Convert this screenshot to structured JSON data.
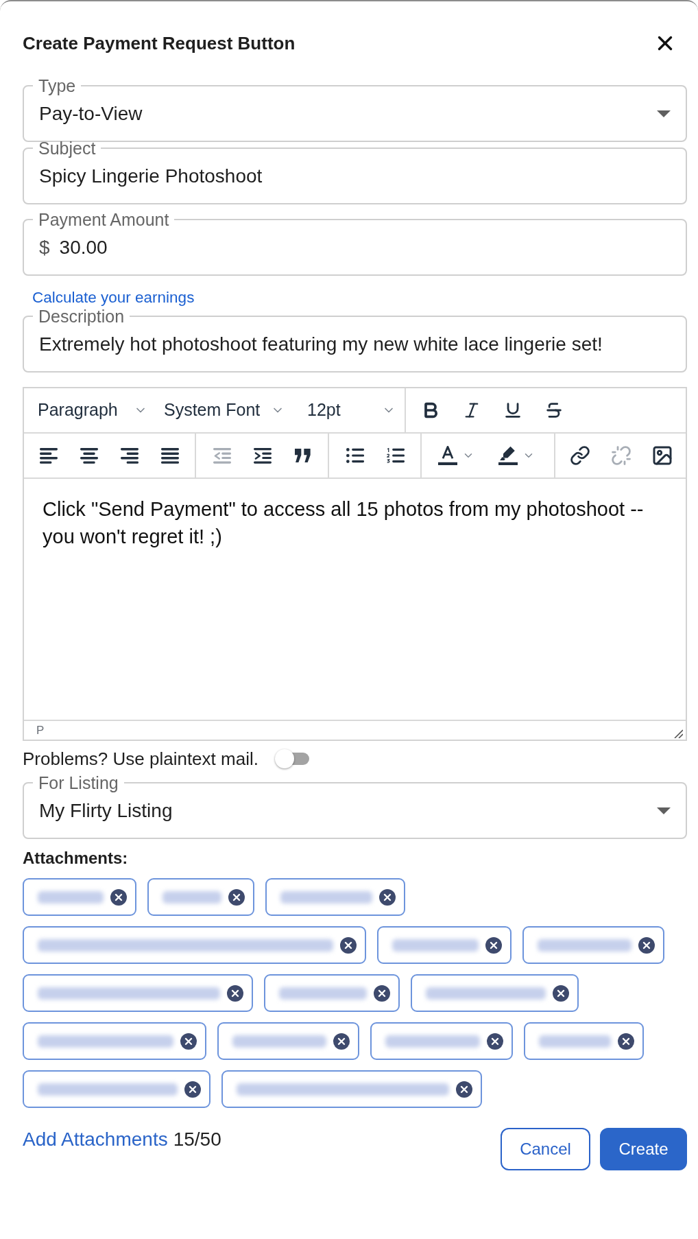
{
  "dialog": {
    "title": "Create Payment Request Button"
  },
  "fields": [
    {
      "kind": "select",
      "label": "Type",
      "value": "Pay-to-View"
    },
    {
      "kind": "text",
      "label": "Subject",
      "value": "Spicy Lingerie Photoshoot"
    },
    {
      "kind": "currency",
      "label": "Payment Amount",
      "prefix": "$",
      "value": "30.00",
      "link": "Calculate your earnings"
    },
    {
      "kind": "text",
      "label": "Description",
      "value": "Extremely hot photoshoot featuring my new white lace lingerie set!"
    }
  ],
  "editor": {
    "toolbar_rows": [
      {
        "groups": [
          [
            {
              "kind": "select",
              "value": "Paragraph"
            },
            {
              "kind": "select",
              "value": "System Font"
            },
            {
              "kind": "select",
              "value": "12pt"
            }
          ],
          [
            {
              "kind": "bold",
              "disabled": false
            },
            {
              "kind": "italic",
              "disabled": false
            },
            {
              "kind": "underline",
              "disabled": false
            },
            {
              "kind": "strikethrough",
              "disabled": false
            }
          ]
        ]
      },
      {
        "groups": [
          [
            {
              "kind": "align_left",
              "disabled": false
            },
            {
              "kind": "align_center",
              "disabled": false
            },
            {
              "kind": "align_right",
              "disabled": false
            },
            {
              "kind": "align_justify",
              "disabled": false
            }
          ],
          [
            {
              "kind": "outdent",
              "disabled": true
            },
            {
              "kind": "indent",
              "disabled": false
            },
            {
              "kind": "blockquote",
              "disabled": false
            }
          ],
          [
            {
              "kind": "bullet_list",
              "disabled": false
            },
            {
              "kind": "numbered_list",
              "disabled": false
            }
          ],
          [
            {
              "kind": "text_color",
              "disabled": false
            },
            {
              "kind": "highlight",
              "disabled": false
            }
          ],
          [
            {
              "kind": "link",
              "disabled": false
            },
            {
              "kind": "unlink",
              "disabled": true
            },
            {
              "kind": "image",
              "disabled": false
            }
          ]
        ]
      }
    ],
    "content": "Click \"Send Payment\" to access all 15 photos from my photoshoot -- you won't regret it! ;)",
    "path": "P"
  },
  "plaintext": {
    "label": "Problems? Use plaintext mail.",
    "on": false
  },
  "listing": {
    "kind": "select",
    "label": "For Listing",
    "value": "My Flirty Listing"
  },
  "attachments": {
    "label": "Attachments:",
    "files": [
      {
        "redacted": true
      },
      {
        "redacted": true
      },
      {
        "redacted": true
      },
      {
        "redacted": true
      },
      {
        "redacted": true
      },
      {
        "redacted": true
      },
      {
        "redacted": true
      },
      {
        "redacted": true
      },
      {
        "redacted": true
      },
      {
        "redacted": true
      },
      {
        "redacted": true
      },
      {
        "redacted": true
      },
      {
        "redacted": true
      },
      {
        "redacted": true
      },
      {
        "redacted": true
      }
    ],
    "add_link": "Add Attachments",
    "count": "15/50"
  },
  "actions": [
    {
      "kind": "secondary",
      "label": "Cancel"
    },
    {
      "kind": "primary",
      "label": "Create"
    }
  ]
}
